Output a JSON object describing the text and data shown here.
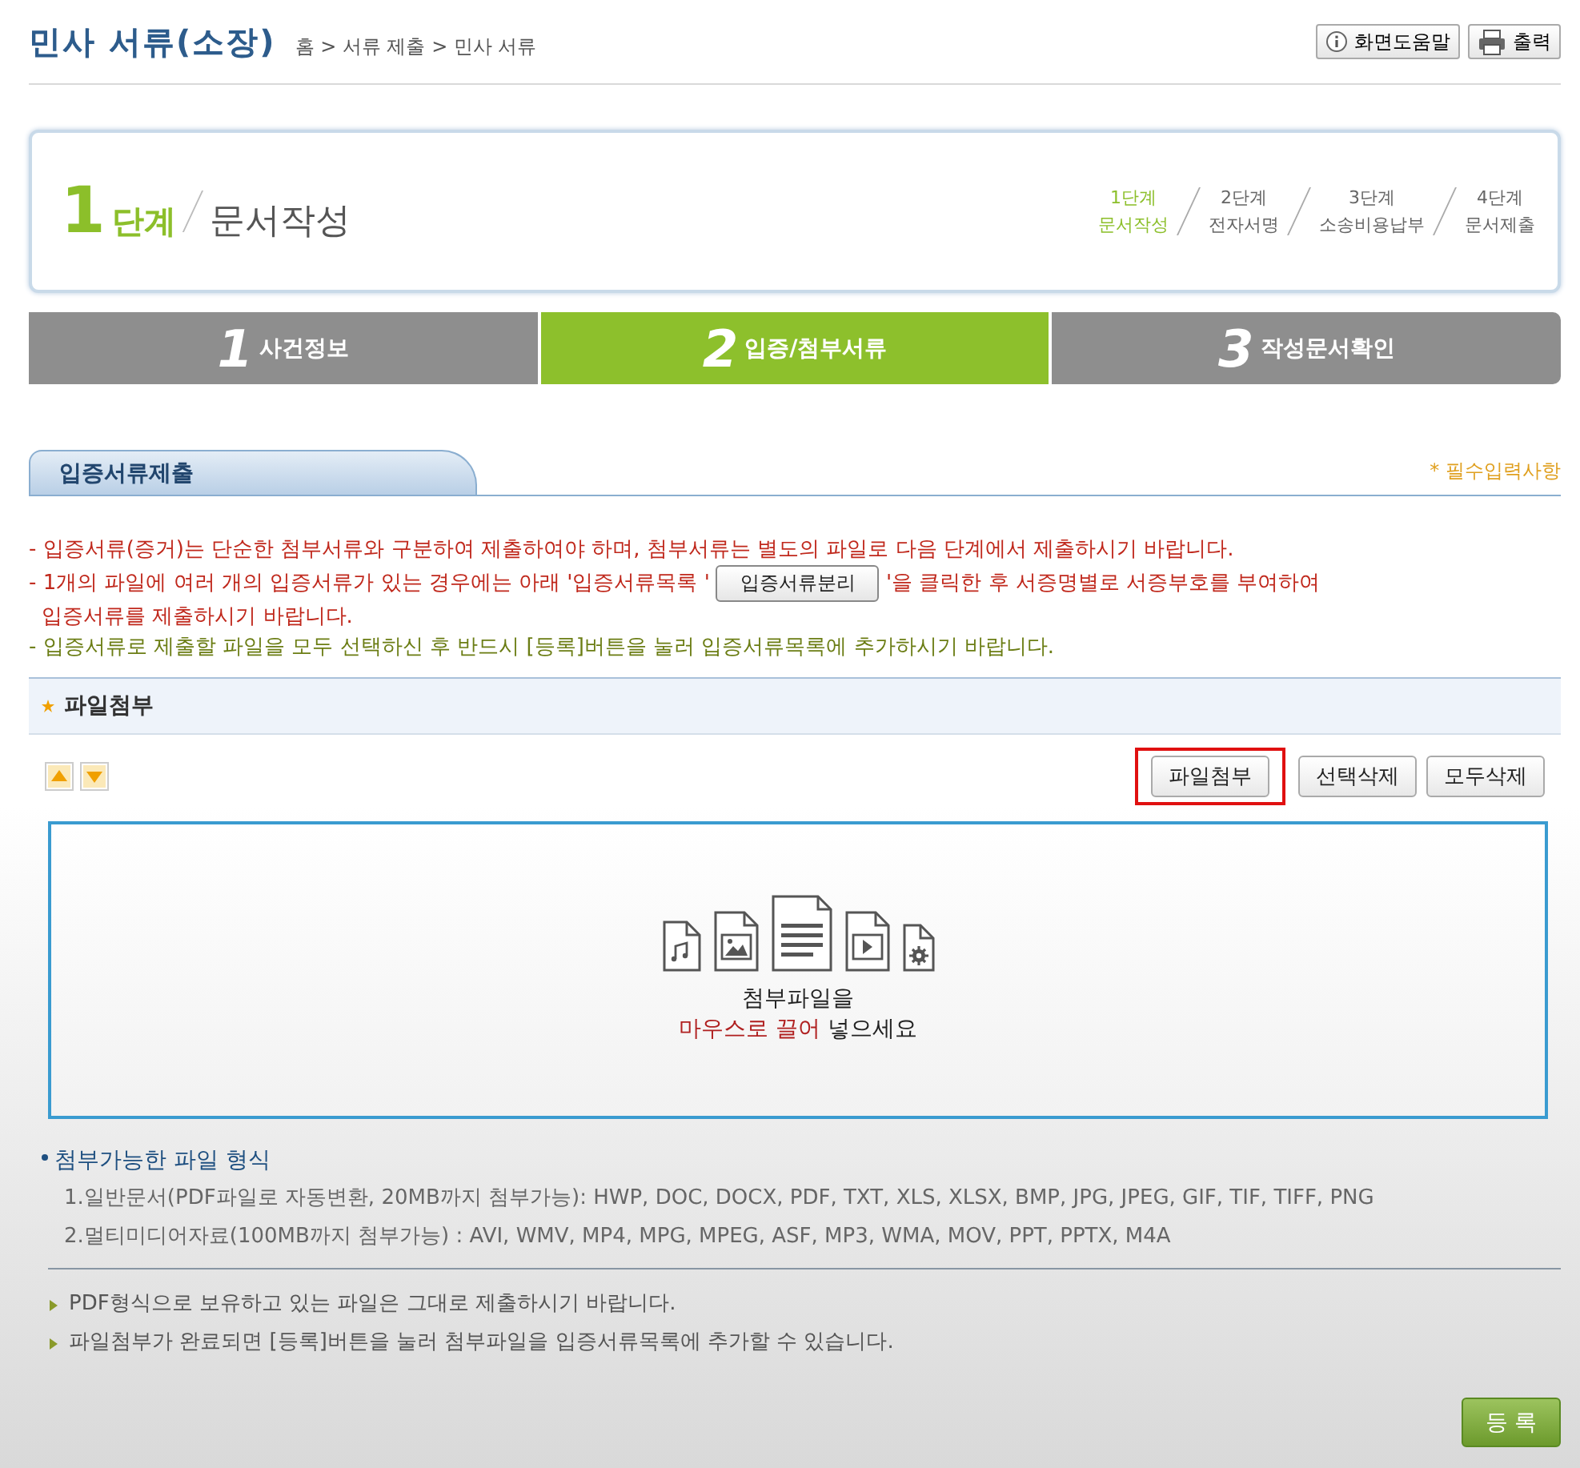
{
  "header": {
    "title": "민사 서류(소장)",
    "breadcrumb": "홈 > 서류 제출 > 민사 서류",
    "buttons": [
      {
        "label": "화면도움말",
        "kind": "help"
      },
      {
        "label": "출력",
        "kind": "print"
      }
    ]
  },
  "step_box": {
    "number": "1",
    "unit": "단계",
    "name": "문서작성",
    "steps": [
      {
        "label": "1단계",
        "name": "문서작성",
        "selected": true
      },
      {
        "label": "2단계",
        "name": "전자서명",
        "selected": false
      },
      {
        "label": "3단계",
        "name": "소송비용납부",
        "selected": false
      },
      {
        "label": "4단계",
        "name": "문서제출",
        "selected": false
      }
    ]
  },
  "tabs": [
    {
      "number": "1",
      "label": "사건정보",
      "selected": false
    },
    {
      "number": "2",
      "label": "입증/첨부서류",
      "selected": true
    },
    {
      "number": "3",
      "label": "작성문서확인",
      "selected": false
    }
  ],
  "section": {
    "title": "입증서류제출",
    "required_note": "* 필수입력사항"
  },
  "notices": [
    {
      "color": "#c0281c",
      "text": "- 입증서류(증거)는 단순한 첨부서류와 구분하여 제출하여야 하며, 첨부서류는 별도의 파일로 다음 단계에서 제출하시기 바랍니다."
    },
    {
      "color": "#c0281c",
      "text": "- 1개의 파일에 여러 개의 입증서류가 있는 경우에는 아래 '입증서류목록 '",
      "button": "입증서류분리",
      "text_after": "'을 클릭한 후 서증명별로 서증부호를 부여하여",
      "continuation": "입증서류를 제출하시기 바랍니다."
    },
    {
      "color": "#6b7d14",
      "text": "- 입증서류로 제출할 파일을 모두 선택하신 후 반드시 [등록]버튼을 눌러 입증서류목록에 추가하시기 바랍니다."
    }
  ],
  "attach": {
    "title": "파일첨부",
    "buttons": [
      {
        "label": "파일첨부",
        "highlighted": true
      },
      {
        "label": "선택삭제",
        "highlighted": false
      },
      {
        "label": "모두삭제",
        "highlighted": false
      }
    ],
    "drop_zone": {
      "line1": "첨부파일을",
      "emphasis": "마우스로 끌어",
      "rest": "넣으세요"
    }
  },
  "formats": {
    "title": "첨부가능한 파일 형식",
    "lines": [
      "1.일반문서(PDF파일로 자동변환, 20MB까지 첨부가능): HWP, DOC, DOCX, PDF, TXT, XLS, XLSX, BMP, JPG, JPEG, GIF, TIF, TIFF, PNG",
      "2.멀티미디어자료(100MB까지 첨부가능) : AVI, WMV, MP4, MPG, MPEG, ASF, MP3, WMA, MOV, PPT, PPTX, M4A"
    ]
  },
  "notes": [
    "PDF형식으로 보유하고 있는 파일은 그대로 제출하시기 바랍니다.",
    "파일첨부가 완료되면 [등록]버튼을 눌러 첨부파일을 입증서류목록에 추가할 수 있습니다."
  ],
  "submit_button": "등 록"
}
